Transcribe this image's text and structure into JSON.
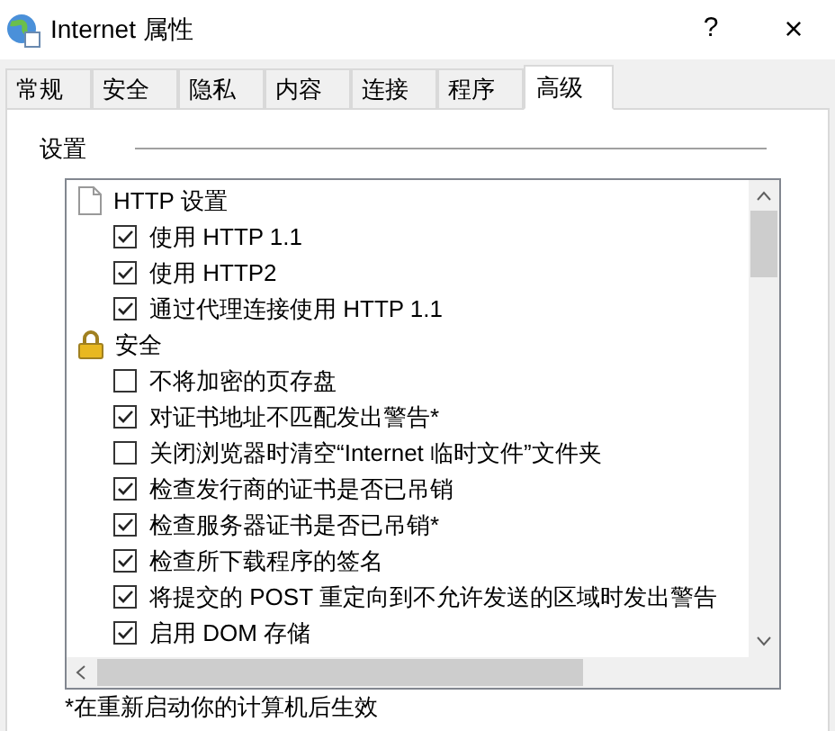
{
  "window": {
    "title": "Internet 属性",
    "help": "?",
    "close": "×"
  },
  "tabs": [
    {
      "label": "常规",
      "selected": false
    },
    {
      "label": "安全",
      "selected": false
    },
    {
      "label": "隐私",
      "selected": false
    },
    {
      "label": "内容",
      "selected": false
    },
    {
      "label": "连接",
      "selected": false
    },
    {
      "label": "程序",
      "selected": false
    },
    {
      "label": "高级",
      "selected": true
    }
  ],
  "settings": {
    "label": "设置",
    "categories": [
      {
        "label": "HTTP 设置",
        "children": [
          {
            "label": "使用 HTTP 1.1",
            "checked": true
          },
          {
            "label": "使用 HTTP2",
            "checked": true
          },
          {
            "label": "通过代理连接使用 HTTP 1.1",
            "checked": true
          }
        ]
      },
      {
        "label": "安全",
        "children": [
          {
            "label": "不将加密的页存盘",
            "checked": false
          },
          {
            "label": "对证书地址不匹配发出警告*",
            "checked": true
          },
          {
            "label": "关闭浏览器时清空“Internet 临时文件”文件夹",
            "checked": false
          },
          {
            "label": "检查发行商的证书是否已吊销",
            "checked": true
          },
          {
            "label": "检查服务器证书是否已吊销*",
            "checked": true
          },
          {
            "label": "检查所下载程序的签名",
            "checked": true
          },
          {
            "label": "将提交的 POST 重定向到不允许发送的区域时发出警告",
            "checked": true
          },
          {
            "label": "启用 DOM 存储",
            "checked": true
          }
        ]
      }
    ]
  },
  "footnote": "*在重新启动你的计算机后生效"
}
